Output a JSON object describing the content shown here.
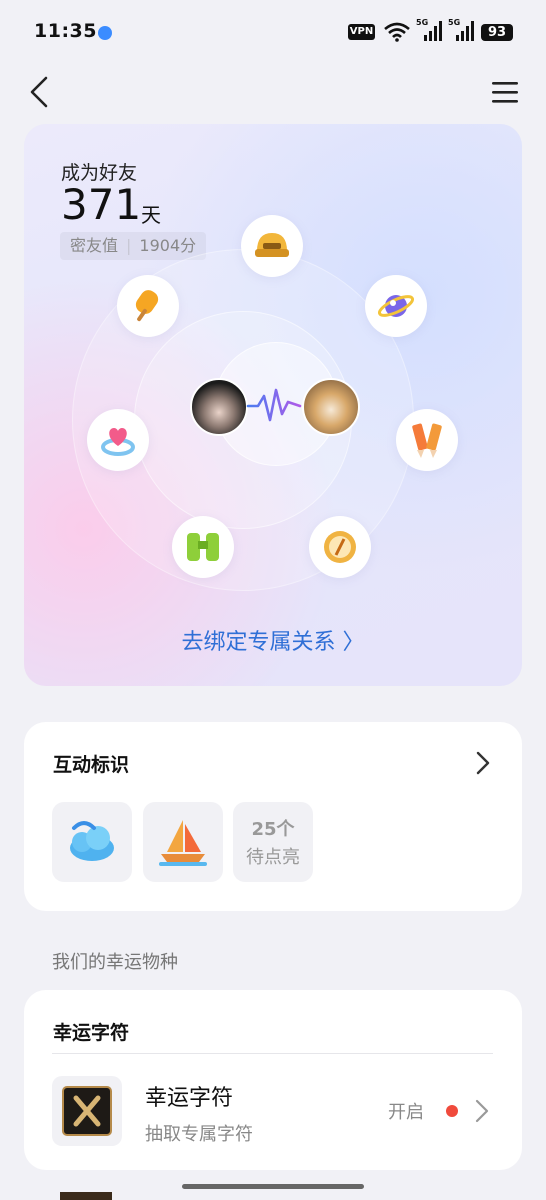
{
  "status_bar": {
    "time": "11:35",
    "vpn": "VPN",
    "signal1": "5G",
    "signal2": "5G",
    "battery": "93"
  },
  "hero": {
    "label": "成为好友",
    "days": "371",
    "days_unit": "天",
    "score_label": "密友值",
    "score_value": "1904分",
    "bind_link": "去绑定专属关系 〉",
    "accent_color": "#2f6fd6"
  },
  "interaction": {
    "title": "互动标识",
    "pending_count": "25个",
    "pending_label": "待点亮"
  },
  "lucky_section": {
    "heading": "我们的幸运物种"
  },
  "lucky_card": {
    "title": "幸运字符",
    "item_title": "幸运字符",
    "item_subtitle": "抽取专属字符",
    "item_state": "开启",
    "dot_color": "#f04a3c"
  }
}
